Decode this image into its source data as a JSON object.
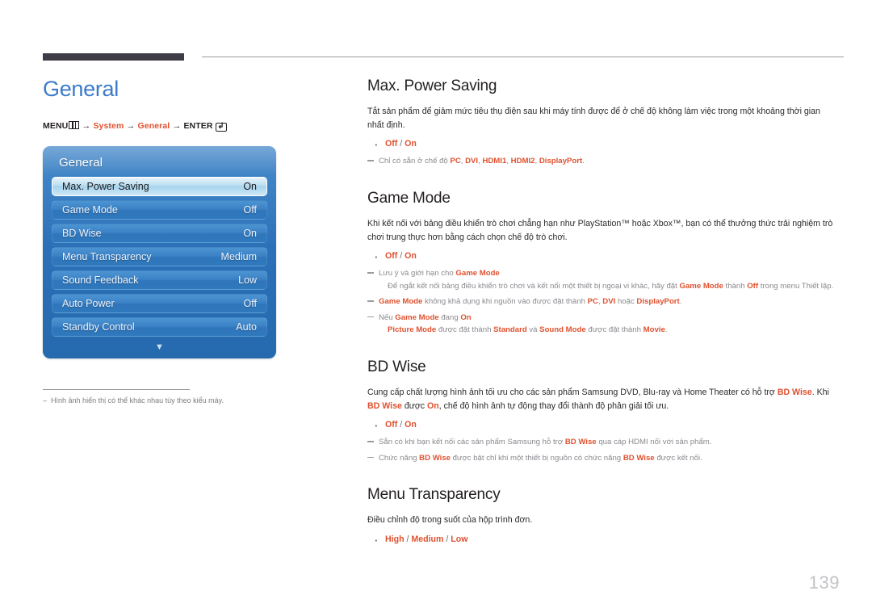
{
  "chapter": {
    "title": "General"
  },
  "breadcrumb": {
    "menu_label": "MENU",
    "menu_icon": "menu-bars-icon",
    "arrow": "→",
    "item1": "System",
    "item2": "General",
    "enter_label": "ENTER",
    "enter_icon": "enter-return-icon",
    "enter_glyph": "↲"
  },
  "osd": {
    "title": "General",
    "rows": [
      {
        "label": "Max. Power Saving",
        "value": "On",
        "selected": true
      },
      {
        "label": "Game Mode",
        "value": "Off",
        "selected": false
      },
      {
        "label": "BD Wise",
        "value": "On",
        "selected": false
      },
      {
        "label": "Menu Transparency",
        "value": "Medium",
        "selected": false
      },
      {
        "label": "Sound Feedback",
        "value": "Low",
        "selected": false
      },
      {
        "label": "Auto Power",
        "value": "Off",
        "selected": false
      },
      {
        "label": "Standby Control",
        "value": "Auto",
        "selected": false
      }
    ],
    "scroll_down_glyph": "▼"
  },
  "left_footnote": {
    "dash": "–",
    "text": "Hình ảnh hiển thị có thể khác nhau tùy theo kiểu máy."
  },
  "sections": {
    "max_power_saving": {
      "heading": "Max. Power Saving",
      "body": "Tắt sản phẩm để giảm mức tiêu thụ điện sau khi máy tính được để ở chế độ không làm việc trong một khoảng thời gian nhất định.",
      "option_a": "Off",
      "option_sep": " / ",
      "option_b": "On",
      "note_pre": "Chỉ có sẵn ở chế độ ",
      "note_hl1": "PC",
      "note_mid1": ", ",
      "note_hl2": "DVI",
      "note_mid2": ", ",
      "note_hl3": "HDMI1",
      "note_mid3": ", ",
      "note_hl4": "HDMI2",
      "note_mid4": ", ",
      "note_hl5": "DisplayPort",
      "note_end": "."
    },
    "game_mode": {
      "heading": "Game Mode",
      "body": "Khi kết nối với bảng điều khiển trò chơi chẳng hạn như PlayStation™ hoặc Xbox™, bạn có thể thưởng thức trải nghiệm trò chơi trung thực hơn bằng cách chọn chế độ trò chơi.",
      "option_a": "Off",
      "option_sep": " / ",
      "option_b": "On",
      "note1_pre": "Lưu ý và giới hạn cho ",
      "note1_hl": "Game Mode",
      "note1_sub_pre": "Để ngắt kết nối bảng điều khiển trò chơi và kết nối một thiết bị ngoại vi khác, hãy đặt ",
      "note1_sub_hl1": "Game Mode",
      "note1_sub_mid": " thành ",
      "note1_sub_hl2": "Off",
      "note1_sub_end": " trong menu Thiết lập.",
      "note2_hl1": "Game Mode",
      "note2_mid1": " không khả dụng khi nguồn vào được đặt thành ",
      "note2_hl2": "PC",
      "note2_mid2": ", ",
      "note2_hl3": "DVI",
      "note2_mid3": " hoặc ",
      "note2_hl4": "DisplayPort",
      "note2_end": ".",
      "note3_pre": "Nếu ",
      "note3_hl1": "Game Mode",
      "note3_mid1": " đang ",
      "note3_hl2": "On",
      "note3_sub_hl1": "Picture Mode",
      "note3_sub_mid1": " được đặt thành ",
      "note3_sub_hl2": "Standard",
      "note3_sub_mid2": " và ",
      "note3_sub_hl3": "Sound Mode",
      "note3_sub_mid3": " được đặt thành ",
      "note3_sub_hl4": "Movie",
      "note3_sub_end": "."
    },
    "bd_wise": {
      "heading": "BD Wise",
      "body_pre": "Cung cấp chất lượng hình ảnh tối ưu cho các sản phẩm Samsung DVD, Blu-ray và Home Theater có hỗ trợ ",
      "body_hl1": "BD Wise",
      "body_mid1": ". Khi ",
      "body_hl2": "BD Wise",
      "body_mid2": " được ",
      "body_hl3": "On",
      "body_end": ", chế độ hình ảnh tự động thay đổi thành độ phân giải tối ưu.",
      "option_a": "Off",
      "option_sep": " / ",
      "option_b": "On",
      "note1_pre": "Sẵn có khi bạn kết nối các sản phẩm Samsung hỗ trợ ",
      "note1_hl": "BD Wise",
      "note1_end": " qua cáp HDMI nối với sản phẩm.",
      "note2_pre": "Chức năng ",
      "note2_hl1": "BD Wise",
      "note2_mid": " được bật chỉ khi một thiết bị nguồn có chức năng ",
      "note2_hl2": "BD Wise",
      "note2_end": " được kết nối."
    },
    "menu_transparency": {
      "heading": "Menu Transparency",
      "body": "Điều chỉnh độ trong suốt của hộp trình đơn.",
      "option_a": "High",
      "option_sep1": " / ",
      "option_b": "Medium",
      "option_sep2": " / ",
      "option_c": "Low"
    }
  },
  "page_number": "139",
  "colors": {
    "accent_orange": "#e0512f",
    "title_blue": "#3b7bc8",
    "osd_blue": "#2f75ba",
    "note_gray": "#8a8a90"
  }
}
